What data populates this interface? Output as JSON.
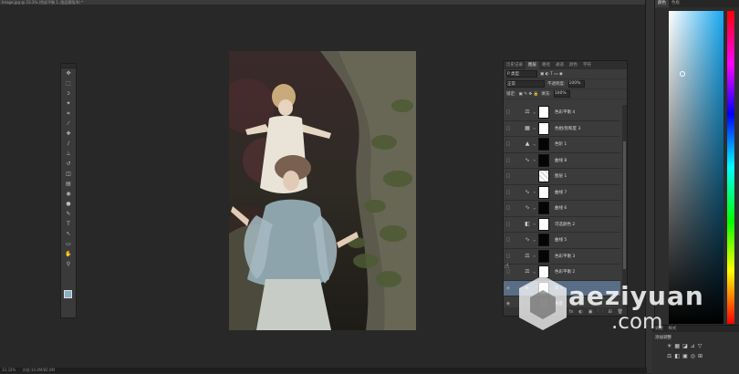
{
  "window": {
    "title": "Image.jpg @ 33.3% (色彩平衡 1, 图层蒙版/8) *"
  },
  "toolbar": {
    "tools": [
      "move",
      "marquee",
      "lasso",
      "quick-select",
      "crop",
      "eyedropper",
      "heal",
      "brush",
      "stamp",
      "history-brush",
      "eraser",
      "gradient",
      "blur",
      "dodge",
      "pen",
      "type",
      "path-select",
      "shape",
      "hand",
      "zoom"
    ],
    "glyphs": [
      "✥",
      "⬚",
      "ↄ",
      "✦",
      "⌗",
      "⁄",
      "✚",
      "∕",
      "⊥",
      "↺",
      "◫",
      "▤",
      "◉",
      "●",
      "✎",
      "T",
      "↖",
      "▭",
      "✋",
      "⚲"
    ]
  },
  "layers_panel": {
    "tabs": [
      "历史记录",
      "图层",
      "路径",
      "通道",
      "颜色",
      "字符"
    ],
    "active_tab": "图层",
    "filter_label": "P 类型",
    "blend_mode": "正常",
    "opacity_label": "不透明度:",
    "opacity_value": "100%",
    "lock_label": "锁定:",
    "fill_label": "填充:",
    "fill_value": "100%",
    "layers": [
      {
        "name": "色彩平衡 4",
        "icon": "⚖",
        "mask": "white",
        "visible": false,
        "selected": false
      },
      {
        "name": "色相/饱和度 3",
        "icon": "▦",
        "mask": "white",
        "visible": false,
        "selected": false
      },
      {
        "name": "色阶 1",
        "icon": "▲",
        "mask": "dark",
        "visible": false,
        "selected": false
      },
      {
        "name": "曲线 8",
        "icon": "∿",
        "mask": "dark",
        "visible": false,
        "selected": false
      },
      {
        "name": "图层 1",
        "icon": "",
        "mask": "none",
        "visible": false,
        "selected": false
      },
      {
        "name": "曲线 7",
        "icon": "∿",
        "mask": "white",
        "visible": false,
        "selected": false
      },
      {
        "name": "曲线 6",
        "icon": "∿",
        "mask": "dark",
        "visible": false,
        "selected": false
      },
      {
        "name": "可选颜色 2",
        "icon": "◧",
        "mask": "white",
        "visible": false,
        "selected": false
      },
      {
        "name": "曲线 5",
        "icon": "∿",
        "mask": "dark",
        "visible": false,
        "selected": false
      },
      {
        "name": "色彩平衡 3",
        "icon": "⚖",
        "mask": "dark",
        "visible": false,
        "selected": false
      },
      {
        "name": "色彩平衡 2",
        "icon": "⚖",
        "mask": "white",
        "visible": false,
        "selected": false
      },
      {
        "name": "组 1",
        "icon": "▸",
        "mask": "white",
        "visible": true,
        "selected": true
      },
      {
        "name": "背景",
        "icon": "",
        "mask": "none",
        "visible": true,
        "selected": false
      }
    ],
    "bottom_icons": [
      "fx",
      "◐",
      "▣",
      "🗀",
      "⊞",
      "🗑"
    ]
  },
  "color_panel": {
    "tabs": [
      "颜色",
      "色板"
    ],
    "accent_color": "#19a8f0"
  },
  "adjustments_panel": {
    "tabs": [
      "调整",
      "样式"
    ],
    "title": "添加调整",
    "icons_row1": [
      "☀",
      "▦",
      "◪",
      "⊿",
      "▽"
    ],
    "icons_row2": [
      "⚖",
      "◧",
      "▣",
      "◎",
      "⊞"
    ]
  },
  "status": {
    "zoom": "33.33%",
    "doc_size": "文档:10.4M/82.6M"
  },
  "watermark": {
    "brand": "aeziyuan",
    "domain": ".com"
  }
}
